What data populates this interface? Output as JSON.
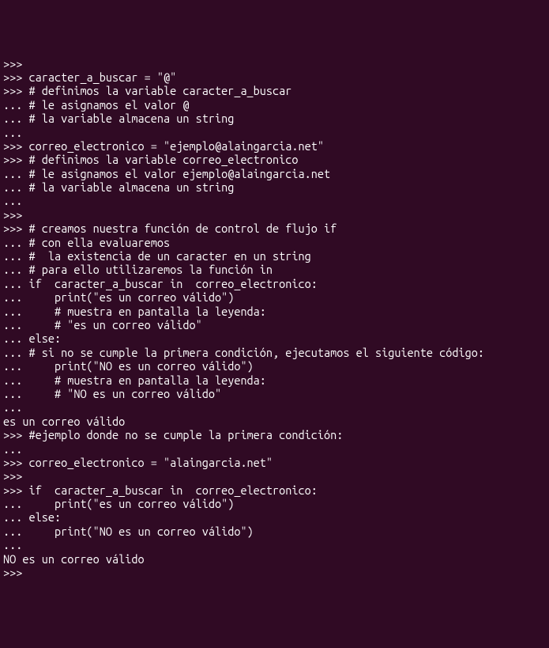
{
  "terminal": {
    "lines": [
      ">>>",
      ">>> caracter_a_buscar = \"@\"",
      ">>> # definimos la variable caracter_a_buscar",
      "... # le asignamos el valor @",
      "... # la variable almacena un string",
      "...",
      ">>> correo_electronico = \"ejemplo@alaingarcia.net\"",
      ">>> # definimos la variable correo_electronico",
      "... # le asignamos el valor ejemplo@alaingarcia.net",
      "... # la variable almacena un string",
      "...",
      ">>>",
      ">>> # creamos nuestra función de control de flujo if",
      "... # con ella evaluaremos",
      "... #  la existencia de un caracter en un string",
      "... # para ello utilizaremos la función in",
      "... if  caracter_a_buscar in  correo_electronico:",
      "...     print(\"es un correo válido\")",
      "...     # muestra en pantalla la leyenda:",
      "...     # \"es un correo válido\"",
      "... else:",
      "... # si no se cumple la primera condición, ejecutamos el siguiente código:",
      "...     print(\"NO es un correo válido\")",
      "...     # muestra en pantalla la leyenda:",
      "...     # \"NO es un correo válido\"",
      "...",
      "es un correo válido",
      ">>> #ejemplo donde no se cumple la primera condición:",
      "...",
      ">>> correo_electronico = \"alaingarcia.net\"",
      ">>>",
      ">>> if  caracter_a_buscar in  correo_electronico:",
      "...     print(\"es un correo válido\")",
      "... else:",
      "...     print(\"NO es un correo válido\")",
      "...",
      "NO es un correo válido",
      ">>>"
    ]
  }
}
